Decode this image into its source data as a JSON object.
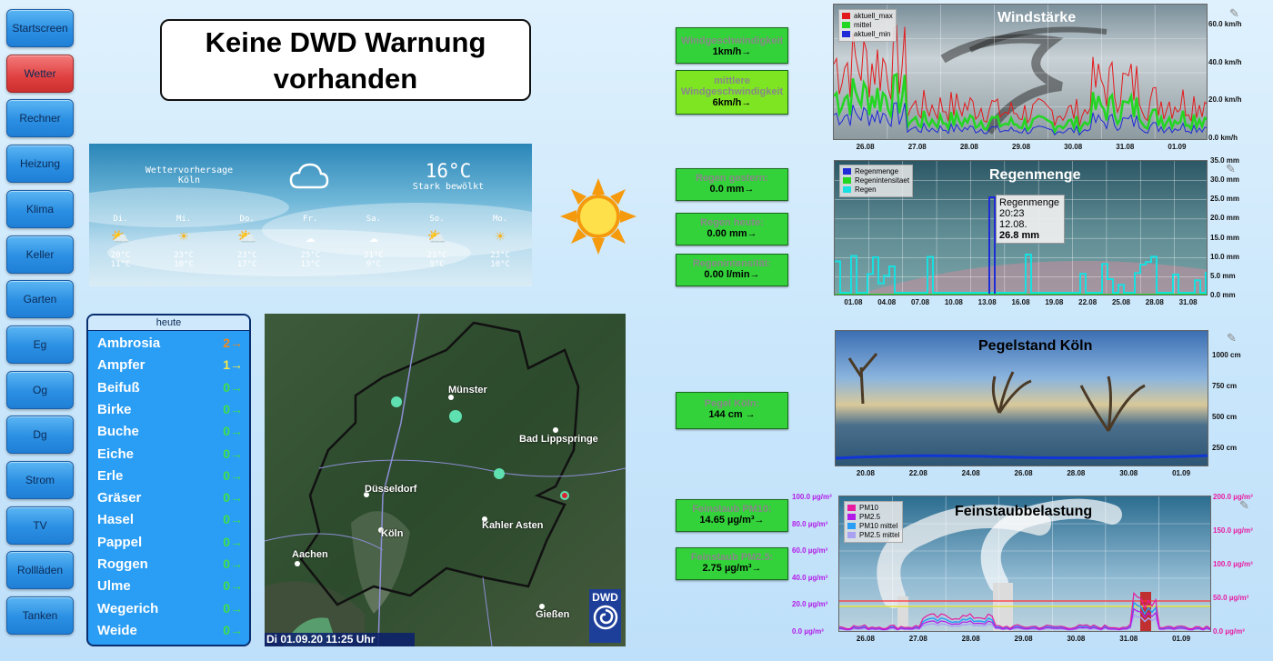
{
  "nav": [
    {
      "label": "Startscreen",
      "active": false
    },
    {
      "label": "Wetter",
      "active": true
    },
    {
      "label": "Rechner",
      "active": false
    },
    {
      "label": "Heizung",
      "active": false
    },
    {
      "label": "Klima",
      "active": false
    },
    {
      "label": "Keller",
      "active": false
    },
    {
      "label": "Garten",
      "active": false
    },
    {
      "label": "Eg",
      "active": false
    },
    {
      "label": "Og",
      "active": false
    },
    {
      "label": "Dg",
      "active": false
    },
    {
      "label": "Strom",
      "active": false
    },
    {
      "label": "TV",
      "active": false
    },
    {
      "label": "Rollläden",
      "active": false
    },
    {
      "label": "Tanken",
      "active": false
    }
  ],
  "warning": {
    "line1": "Keine DWD Warnung",
    "line2": "vorhanden"
  },
  "forecast": {
    "title": "Wettervorhersage",
    "city": "Köln",
    "temp": "16°C",
    "condition": "Stark bewölkt",
    "days": [
      {
        "wd": "Di.",
        "icon": "partly-sunny-icon",
        "hi": "20°C",
        "lo": "11°C"
      },
      {
        "wd": "Mi.",
        "icon": "sun-icon",
        "hi": "23°C",
        "lo": "10°C"
      },
      {
        "wd": "Do.",
        "icon": "partly-sunny-icon",
        "hi": "23°C",
        "lo": "17°C"
      },
      {
        "wd": "Fr.",
        "icon": "cloud-icon",
        "hi": "25°C",
        "lo": "13°C"
      },
      {
        "wd": "Sa.",
        "icon": "cloud-icon",
        "hi": "21°C",
        "lo": "9°C"
      },
      {
        "wd": "So.",
        "icon": "partly-sunny-icon",
        "hi": "21°C",
        "lo": "9°C"
      },
      {
        "wd": "Mo.",
        "icon": "sun-icon",
        "hi": "23°C",
        "lo": "10°C"
      }
    ]
  },
  "pollen": {
    "header": "heute",
    "items": [
      {
        "name": "Ambrosia",
        "value": "2→",
        "color": "#f08a1c"
      },
      {
        "name": "Ampfer",
        "value": "1→",
        "color": "#f5e84a"
      },
      {
        "name": "Beifuß",
        "value": "0→",
        "color": "#3ee04a"
      },
      {
        "name": "Birke",
        "value": "0→",
        "color": "#3ee04a"
      },
      {
        "name": "Buche",
        "value": "0→",
        "color": "#3ee04a"
      },
      {
        "name": "Eiche",
        "value": "0→",
        "color": "#3ee04a"
      },
      {
        "name": "Erle",
        "value": "0→",
        "color": "#3ee04a"
      },
      {
        "name": "Gräser",
        "value": "0→",
        "color": "#3ee04a"
      },
      {
        "name": "Hasel",
        "value": "0→",
        "color": "#3ee04a"
      },
      {
        "name": "Pappel",
        "value": "0→",
        "color": "#3ee04a"
      },
      {
        "name": "Roggen",
        "value": "0→",
        "color": "#3ee04a"
      },
      {
        "name": "Ulme",
        "value": "0→",
        "color": "#3ee04a"
      },
      {
        "name": "Wegerich",
        "value": "0→",
        "color": "#3ee04a"
      },
      {
        "name": "Weide",
        "value": "0→",
        "color": "#3ee04a"
      }
    ]
  },
  "map": {
    "cities": [
      "Münster",
      "Bad Lippspringe",
      "Düsseldorf",
      "Köln",
      "Kahler Asten",
      "Aachen",
      "Gießen"
    ],
    "timestamp": "Di 01.09.20   11:25 Uhr",
    "logo": "DWD"
  },
  "values": {
    "wind_speed": {
      "label": "Windgeschwindigkeit",
      "value": "1km/h→"
    },
    "wind_avg": {
      "label": "mittlere Windgeschwindigkeit",
      "value": "6km/h→"
    },
    "rain_yesterday": {
      "label": "Regen gestern:",
      "value": "0.0 mm→"
    },
    "rain_today": {
      "label": "Regen heute:",
      "value": "0.00 mm→"
    },
    "rain_intensity": {
      "label": "Regenintensität:",
      "value": "0.00 l/min→"
    },
    "level": {
      "label": "Pegel Köln:",
      "value": "144 cm →"
    },
    "pm10": {
      "label": "Feinstaub PM10:",
      "value": "14.65 µg/m³→"
    },
    "pm25": {
      "label": "Feinstaub PM2.5:",
      "value": "2.75 µg/m³→"
    }
  },
  "charts": {
    "wind": {
      "title": "Windstärke",
      "legend": [
        "aktuell_max",
        "mittel",
        "aktuell_min"
      ],
      "yticks": [
        "60.0 km/h",
        "40.0 km/h",
        "20.0 km/h",
        "0.0 km/h"
      ],
      "xticks": [
        "26.08",
        "27.08",
        "28.08",
        "29.08",
        "30.08",
        "31.08",
        "01.09"
      ]
    },
    "rain": {
      "title": "Regenmenge",
      "legend": [
        "Regenmenge",
        "Regenintensitaet",
        "Regen"
      ],
      "yticks": [
        "35.0 mm",
        "30.0 mm",
        "25.0 mm",
        "20.0 mm",
        "15.0 mm",
        "10.0 mm",
        "5.0 mm",
        "0.0 mm"
      ],
      "xticks": [
        "01.08",
        "04.08",
        "07.08",
        "10.08",
        "13.08",
        "16.08",
        "19.08",
        "22.08",
        "25.08",
        "28.08",
        "31.08"
      ],
      "tooltip": {
        "name": "Regenmenge",
        "time": "20:23",
        "date": "12.08.",
        "value": "26.8 mm"
      }
    },
    "level": {
      "title": "Pegelstand Köln",
      "yticks": [
        "1000 cm",
        "750 cm",
        "500 cm",
        "250 cm"
      ],
      "xticks": [
        "20.08",
        "22.08",
        "24.08",
        "26.08",
        "28.08",
        "30.08",
        "01.09"
      ]
    },
    "dust": {
      "title": "Feinstaubbelastung",
      "legend": [
        "PM10",
        "PM2.5",
        "PM10 mittel",
        "PM2.5 mittel"
      ],
      "yticks_left": [
        "100.0 µg/m³",
        "80.0 µg/m³",
        "60.0 µg/m³",
        "40.0 µg/m³",
        "20.0 µg/m³",
        "0.0 µg/m³"
      ],
      "yticks_right": [
        "200.0 µg/m³",
        "150.0 µg/m³",
        "100.0 µg/m³",
        "50.0 µg/m³",
        "0.0 µg/m³"
      ],
      "xticks": [
        "26.08",
        "27.08",
        "28.08",
        "29.08",
        "30.08",
        "31.08",
        "01.09"
      ]
    }
  }
}
